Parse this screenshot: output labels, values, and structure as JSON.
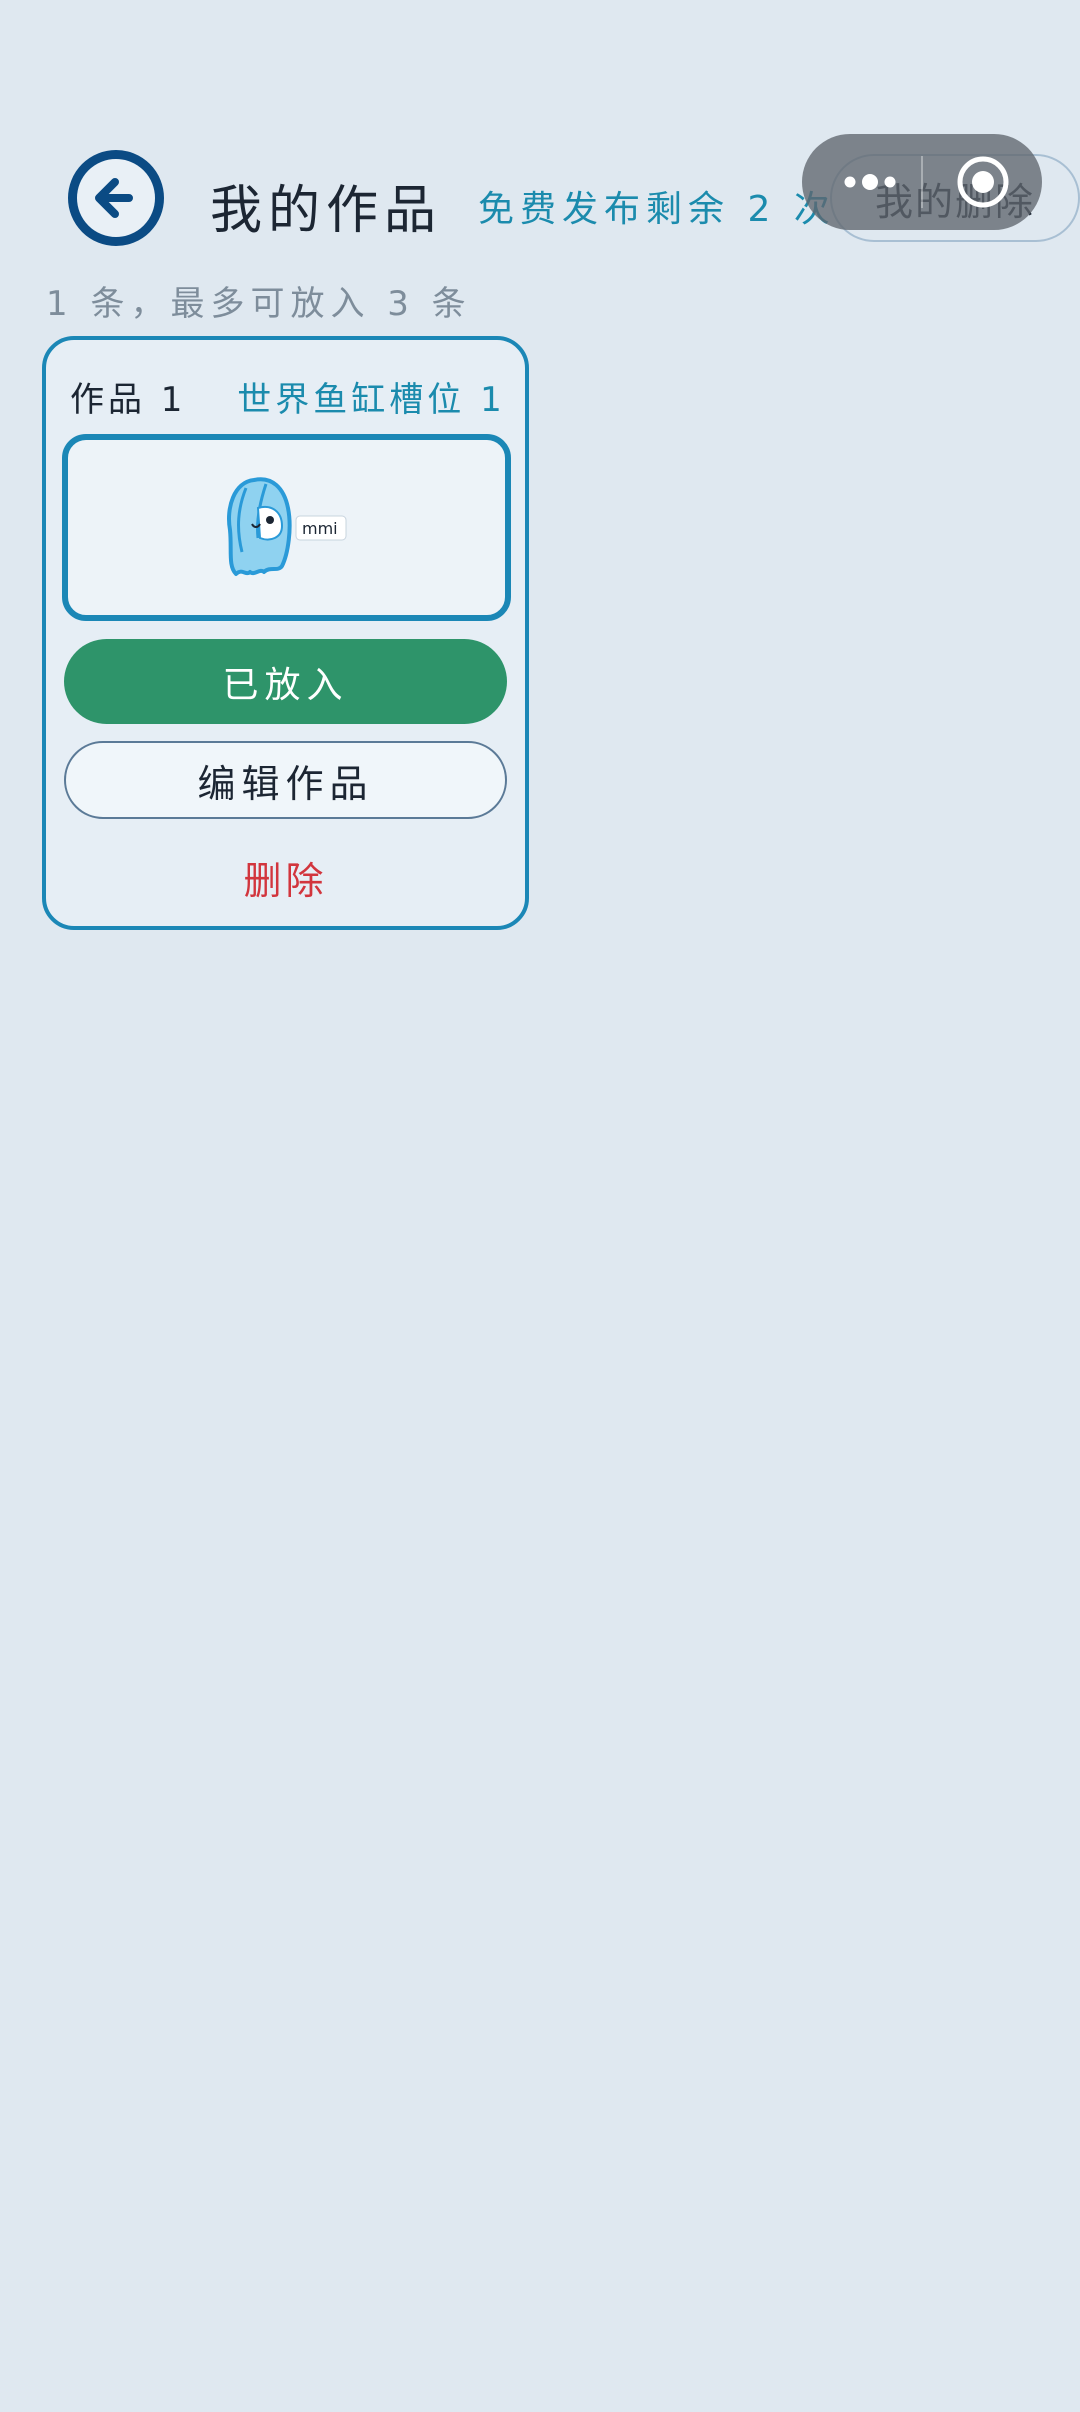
{
  "header": {
    "title": "我的作品",
    "quota": "免费发布剩余 2 次",
    "deleted_link": "我的删除",
    "subline": "1 条，最多可放入 3 条"
  },
  "card": {
    "work_label": "作品 1",
    "slot_label": "世界鱼缸槽位 1",
    "thumb_text": "mmi",
    "placed_label": "已放入",
    "edit_label": "编辑作品",
    "delete_label": "删除"
  },
  "icons": {
    "back": "arrow-left-icon",
    "more": "more-dots-icon",
    "close": "target-circle-icon"
  },
  "colors": {
    "background": "#dfe8f0",
    "accent": "#1b87b6",
    "nav_dark": "#0b4b84",
    "placed_green": "#2e946a",
    "delete_red": "#d2353d"
  }
}
